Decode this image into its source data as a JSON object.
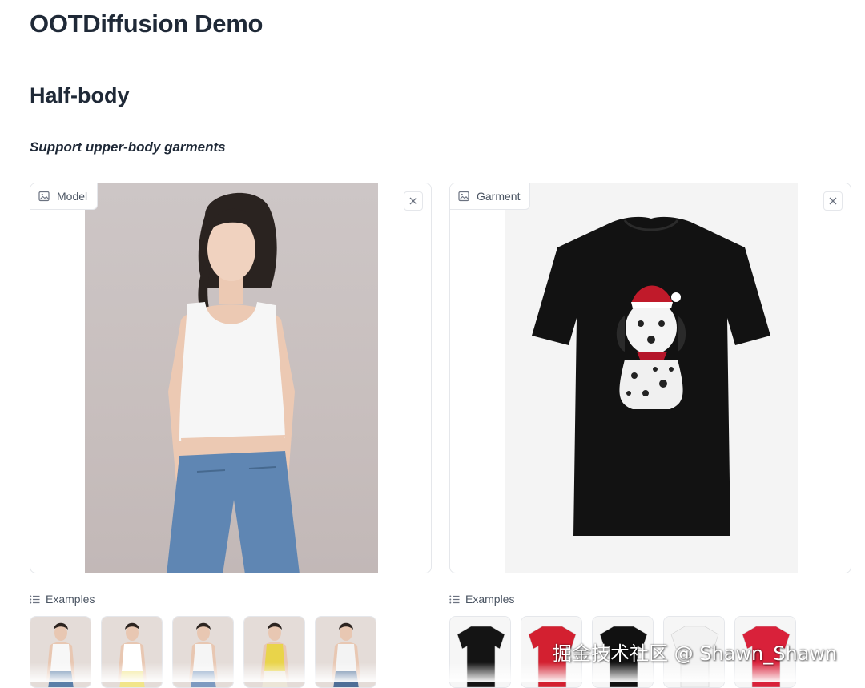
{
  "app": {
    "title": "OOTDiffusion Demo"
  },
  "section": {
    "title": "Half-body",
    "subtitle": "Support upper-body garments"
  },
  "model_panel": {
    "label": "Model",
    "label_icon": "image-icon",
    "close_icon": "close-icon"
  },
  "garment_panel": {
    "label": "Garment",
    "label_icon": "image-icon",
    "close_icon": "close-icon"
  },
  "model_examples": {
    "label": "Examples",
    "icon": "list-icon",
    "items": [
      {
        "name": "model-example-1",
        "top_color": "#f7f7f7",
        "bottom_color": "#5b7fa8"
      },
      {
        "name": "model-example-2",
        "top_color": "#ffffff",
        "bottom_color": "#f1e58a"
      },
      {
        "name": "model-example-3",
        "top_color": "#f5f5f5",
        "bottom_color": "#7d9ac0"
      },
      {
        "name": "model-example-4",
        "top_color": "#e9d44a",
        "bottom_color": "#ece6d8"
      },
      {
        "name": "model-example-5",
        "top_color": "#f3f3f3",
        "bottom_color": "#4e6e97"
      }
    ]
  },
  "garment_examples": {
    "label": "Examples",
    "icon": "list-icon",
    "items": [
      {
        "name": "garment-example-1",
        "color": "#141414"
      },
      {
        "name": "garment-example-2",
        "color": "#d32030"
      },
      {
        "name": "garment-example-3",
        "color": "#111111"
      },
      {
        "name": "garment-example-4",
        "color": "#f2f2f2"
      },
      {
        "name": "garment-example-5",
        "color": "#d9213a"
      }
    ]
  },
  "watermark": "掘金技术社区 @ Shawn_Shawn",
  "colors": {
    "text": "#1f2937",
    "muted": "#4b5563",
    "border": "#e5e7eb"
  }
}
